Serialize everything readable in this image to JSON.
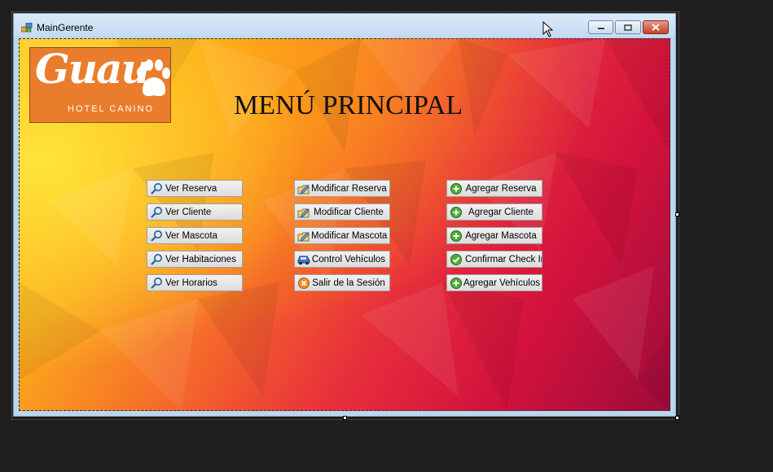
{
  "window": {
    "title": "MainGerente"
  },
  "logo": {
    "script": "Guau",
    "subtitle": "HOTEL CANINO"
  },
  "heading": "MENÚ PRINCIPAL",
  "buttons": {
    "ver_reserva": "Ver Reserva",
    "ver_cliente": "Ver Cliente",
    "ver_mascota": "Ver Mascota",
    "ver_habitaciones": "Ver Habitaciones",
    "ver_horarios": "Ver Horarios",
    "modificar_reserva": "Modificar Reserva",
    "modificar_cliente": "Modificar Cliente",
    "modificar_mascota": "Modificar Mascota",
    "control_vehiculos": "Control Vehículos",
    "salir_sesion": "Salir de la Sesión",
    "agregar_reserva": "Agregar Reserva",
    "agregar_cliente": "Agregar Cliente",
    "agregar_mascota": "Agregar Mascota",
    "confirmar_checkin": "Confirmar Check In",
    "agregar_vehiculos": "Agregar Vehículos"
  },
  "icons": {
    "ver": "magnifier-icon",
    "modificar": "edit-folder-icon",
    "agregar": "green-plus-icon",
    "confirmar": "green-check-icon",
    "vehiculo": "car-icon",
    "salir": "exit-icon"
  },
  "colors": {
    "logo_bg": "#ea7d2c",
    "background_from": "#fcd523",
    "background_to": "#9d0b3a"
  }
}
